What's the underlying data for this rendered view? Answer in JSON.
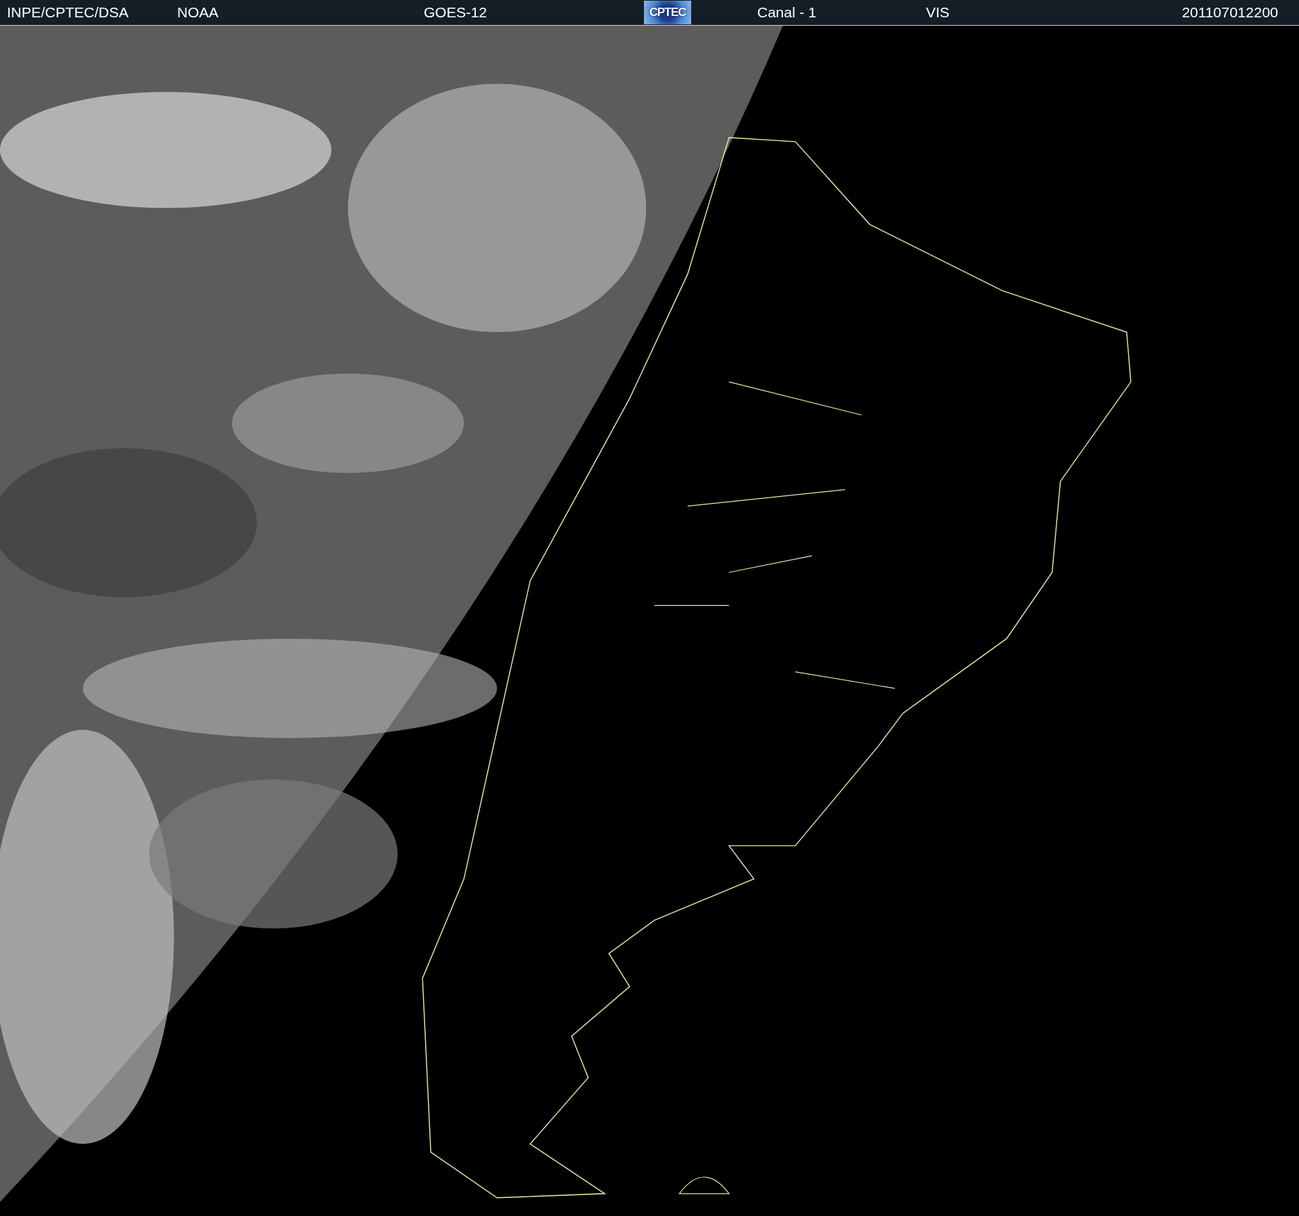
{
  "header": {
    "items": [
      {
        "kind": "text",
        "text": "INPE/CPTEC/DSA"
      },
      {
        "kind": "text",
        "text": "NOAA"
      },
      {
        "kind": "text",
        "text": "GOES-12"
      },
      {
        "kind": "logo",
        "text": "CPTEC"
      },
      {
        "kind": "text",
        "text": "Canal - 1"
      },
      {
        "kind": "text",
        "text": "VIS"
      },
      {
        "kind": "text",
        "text": "201107012200"
      }
    ]
  }
}
